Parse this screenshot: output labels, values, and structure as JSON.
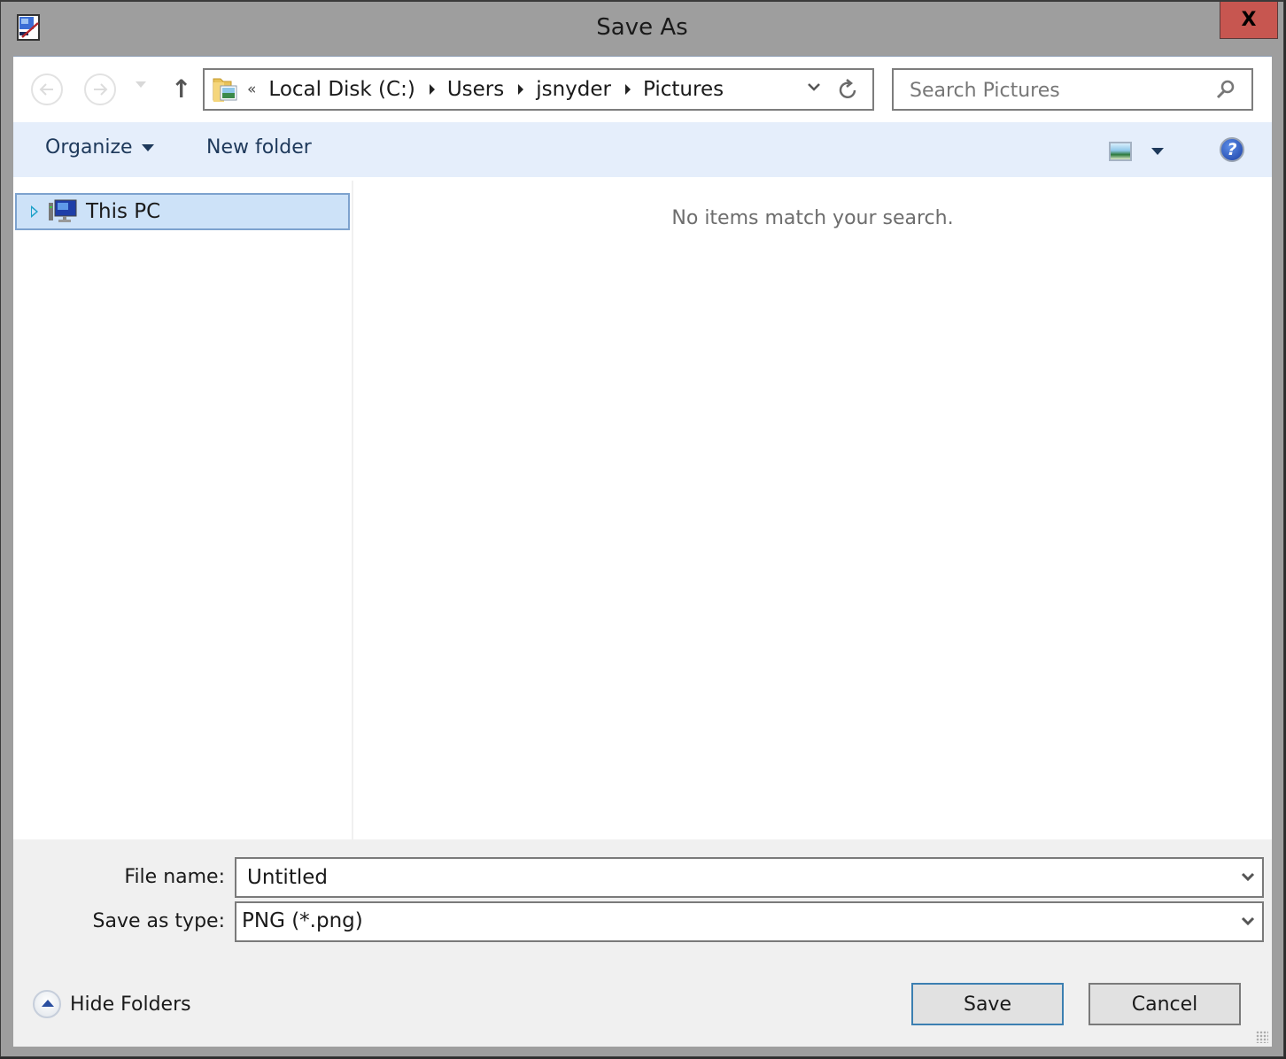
{
  "window": {
    "title": "Save As",
    "close_label": "X"
  },
  "nav": {
    "back_label": "Back",
    "forward_label": "Forward",
    "up_arrow": "↑",
    "address": {
      "overflow_chevron": "«",
      "crumbs": [
        "Local Disk (C:)",
        "Users",
        "jsnyder",
        "Pictures"
      ],
      "dropdown_glyph": "⌄",
      "refresh_glyph": "↻"
    },
    "search": {
      "placeholder": "Search Pictures"
    }
  },
  "commandbar": {
    "organize_label": "Organize",
    "new_folder_label": "New folder",
    "help_glyph": "?"
  },
  "tree": {
    "items": [
      {
        "label": "This PC",
        "selected": true,
        "expandable": true
      }
    ]
  },
  "content": {
    "empty_message": "No items match your search."
  },
  "form": {
    "file_name_label": "File name:",
    "file_name_value": "Untitled",
    "save_type_label": "Save as type:",
    "save_type_value": "PNG (*.png)"
  },
  "footer": {
    "hide_folders_label": "Hide Folders",
    "save_label": "Save",
    "cancel_label": "Cancel"
  },
  "colors": {
    "close_button": "#c75650",
    "command_bar": "#e5eefb",
    "tree_selection": "#cde2f8",
    "primary_button_border": "#3c7fb1"
  }
}
